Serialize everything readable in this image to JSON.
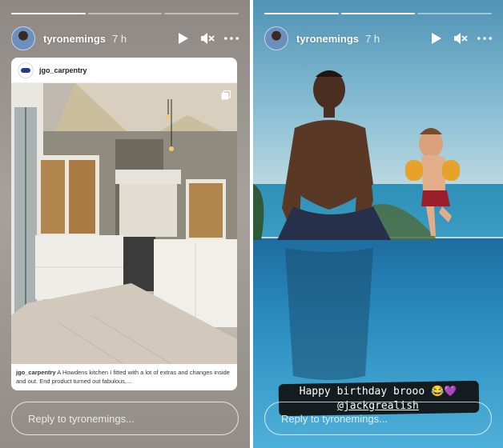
{
  "stories": [
    {
      "user": "tyronemings",
      "time": "7 h",
      "progress": [
        1,
        0,
        0
      ],
      "shared_post": {
        "username": "jgo_carpentry",
        "caption_user": "jgo_carpentry",
        "caption_text": "A Howdens kitchen I fitted with a lot of extras and changes inside and out. End product turned out fabulous,..."
      },
      "reply_placeholder": "Reply to tyronemings..."
    },
    {
      "user": "tyronemings",
      "time": "7 h",
      "progress": [
        1,
        1,
        0
      ],
      "text_line1": "Happy birthday brooo 😂💜",
      "text_line2": "@jackgrealish",
      "reply_placeholder": "Reply to tyronemings..."
    }
  ],
  "icons": {
    "play": "play-icon",
    "mute": "mute-icon",
    "more": "more-icon",
    "multi": "multiple-images-icon"
  },
  "colors": {
    "bar_fill": "#ffffff",
    "bar_empty": "#ffffff73"
  }
}
